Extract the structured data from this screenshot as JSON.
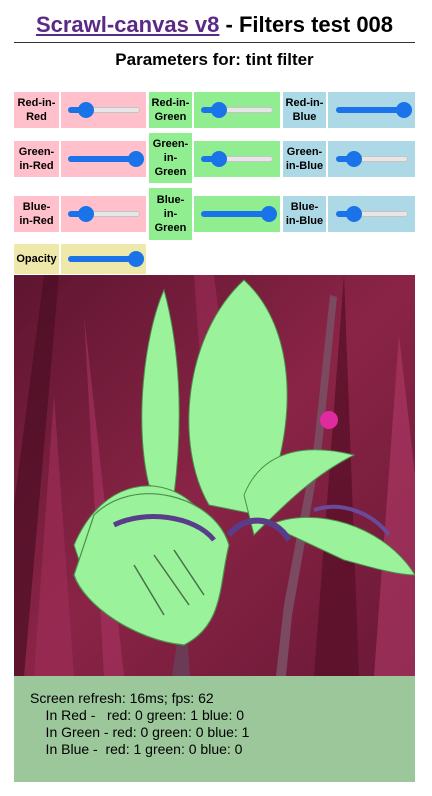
{
  "header": {
    "link_text": "Scrawl-canvas v8",
    "title_rest": " - Filters test 008"
  },
  "subtitle": "Parameters for: tint filter",
  "controls": {
    "red_in_red": {
      "label": "Red-in-Red",
      "value": 0.25
    },
    "red_in_green": {
      "label": "Red-in-Green",
      "value": 0.25
    },
    "red_in_blue": {
      "label": "Red-in-Blue",
      "value": 0.95
    },
    "green_in_red": {
      "label": "Green-in-Red",
      "value": 0.95
    },
    "green_in_green": {
      "label": "Green-in-Green",
      "value": 0.25
    },
    "green_in_blue": {
      "label": "Green-in-Blue",
      "value": 0.25
    },
    "blue_in_red": {
      "label": "Blue-in-Red",
      "value": 0.25
    },
    "blue_in_green": {
      "label": "Blue-in-Green",
      "value": 0.95
    },
    "blue_in_blue": {
      "label": "Blue-in-Blue",
      "value": 0.25
    },
    "opacity": {
      "label": "Opacity",
      "value": 0.95
    }
  },
  "status": {
    "line1": "Screen refresh: 16ms; fps: 62",
    "line2": "    In Red -   red: 0 green: 1 blue: 0",
    "line3": "    In Green - red: 0 green: 0 blue: 1",
    "line4": "    In Blue -  red: 1 green: 0 blue: 0"
  },
  "colors": {
    "red_cell": "#ffc0cb",
    "green_cell": "#90ee90",
    "blue_cell": "#add8e6",
    "opacity_cell": "#eee8aa",
    "slider_accent": "#1a73e8",
    "status_bg": "#9bc79b",
    "photo_background": "#7a1d3c",
    "photo_flower": "#9af29a"
  }
}
